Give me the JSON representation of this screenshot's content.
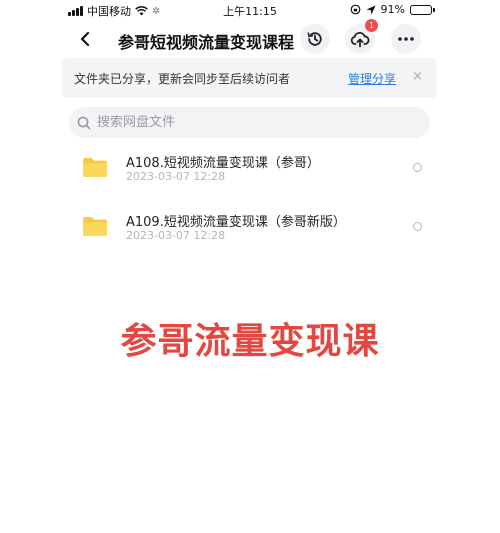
{
  "status_bar": {
    "carrier": "中国移动",
    "time": "上午11:15",
    "battery": "91%",
    "battery_level": 0.91
  },
  "nav": {
    "title": "参哥短视频流量变现课程",
    "upload_badge": "1"
  },
  "share_banner": {
    "text": "文件夹已分享，更新会同步至后续访问者",
    "manage_label": "管理分享",
    "close_label": "×"
  },
  "search": {
    "placeholder": "搜索网盘文件"
  },
  "files": [
    {
      "name": "A108.短视频流量变现课（参哥）",
      "date": "2023-03-07 12:28"
    },
    {
      "name": "A109.短视频流量变现课（参哥新版）",
      "date": "2023-03-07 12:28"
    }
  ],
  "overlay": {
    "caption": "参哥流量变现课"
  },
  "colors": {
    "accent": "#2c7be5",
    "folder": "#f7c944",
    "caption": "#e4473f",
    "badge": "#f04e4e"
  }
}
